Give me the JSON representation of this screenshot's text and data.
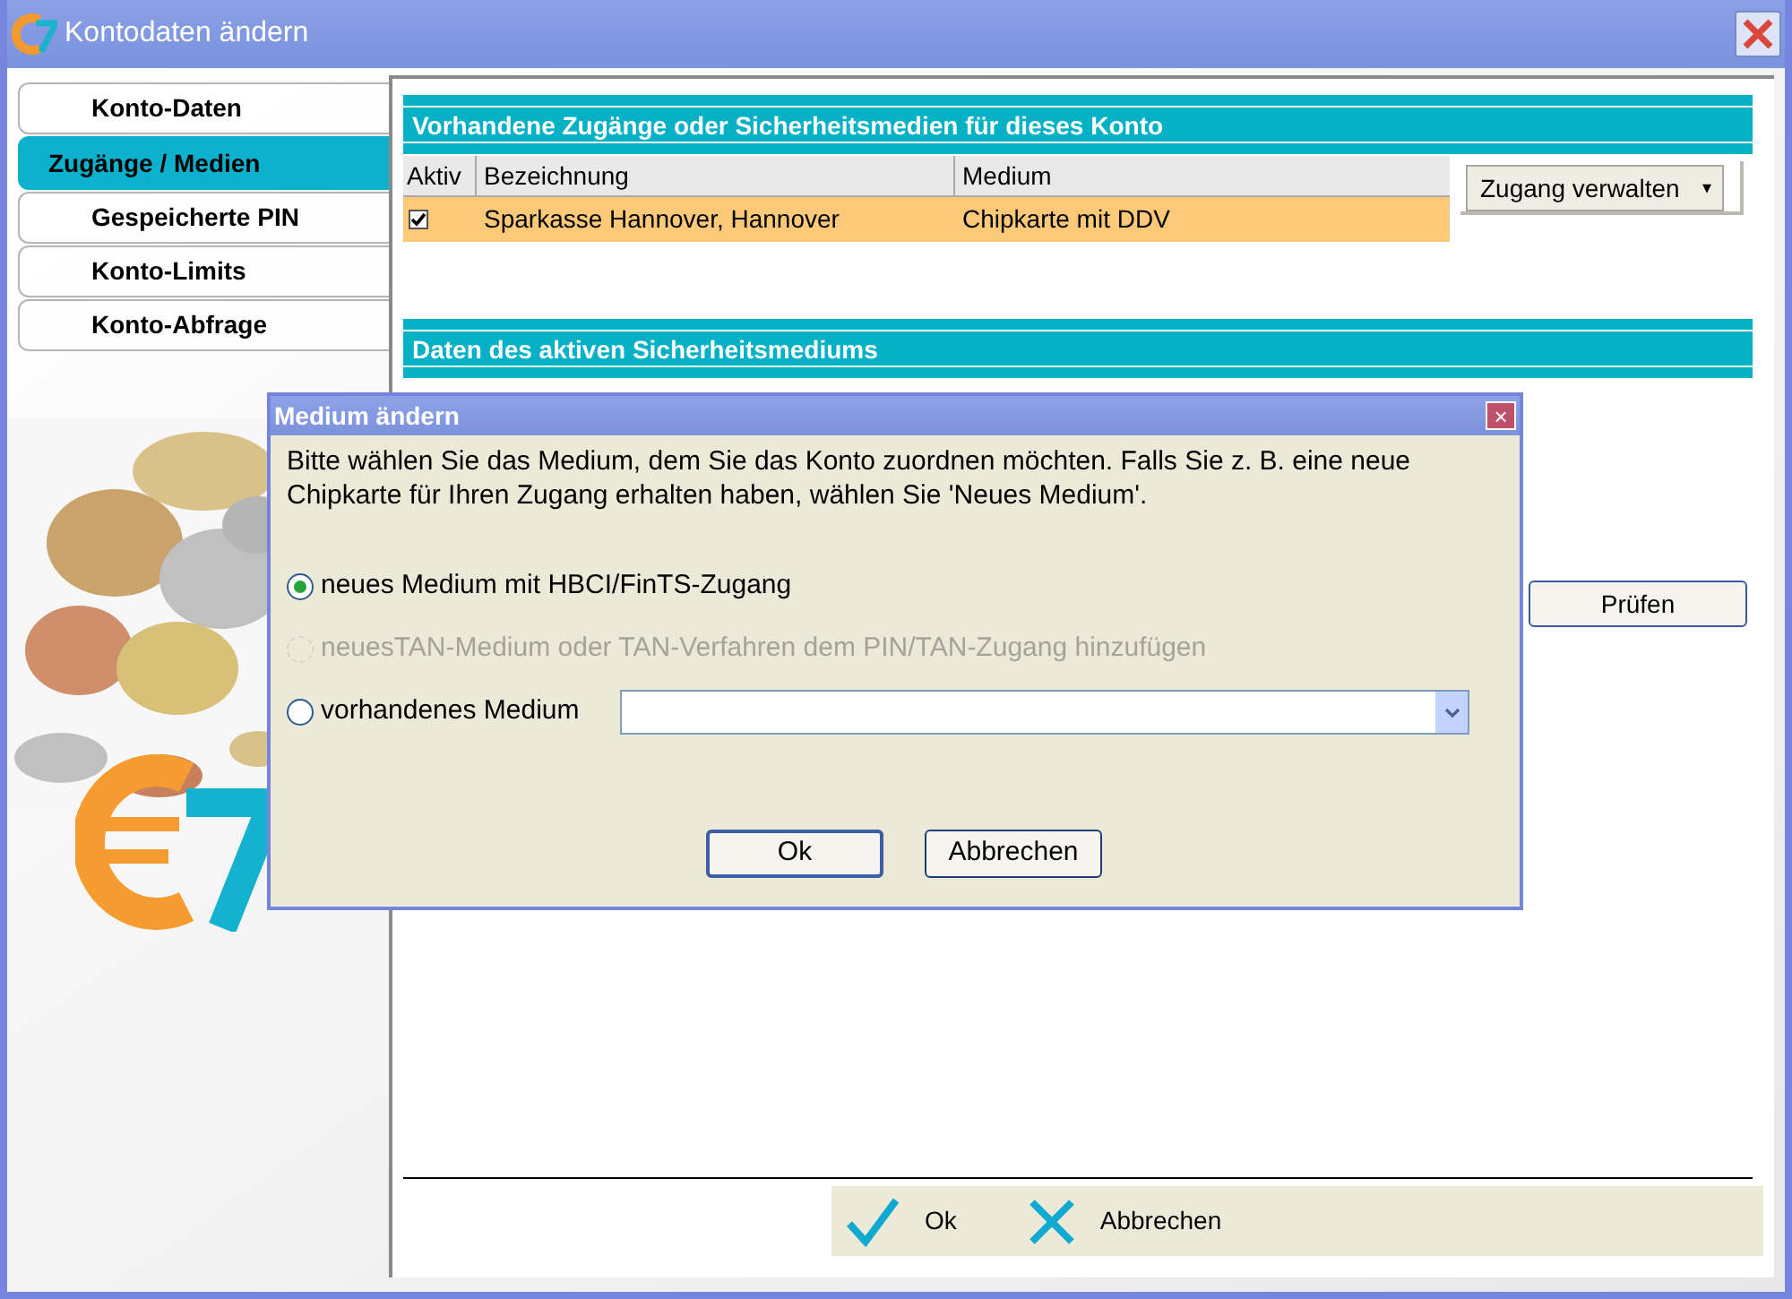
{
  "window": {
    "title": "Kontodaten ändern"
  },
  "tabs": [
    {
      "label": "Konto-Daten",
      "selected": false
    },
    {
      "label": "Zugänge / Medien",
      "selected": true
    },
    {
      "label": "Gespeicherte PIN",
      "selected": false
    },
    {
      "label": "Konto-Limits",
      "selected": false
    },
    {
      "label": "Konto-Abfrage",
      "selected": false
    }
  ],
  "access_section": {
    "title": "Vorhandene Zugänge oder Sicherheitsmedien für dieses Konto",
    "table": {
      "columns": [
        "Aktiv",
        "Bezeichnung",
        "Medium"
      ],
      "rows": [
        {
          "checked": true,
          "selected": true,
          "name": "Sparkasse Hannover, Hannover",
          "medium": "Chipkarte mit DDV"
        }
      ]
    },
    "manage_button": {
      "label": "Zugang verwalten",
      "caret": "▾"
    }
  },
  "medium_section": {
    "title": "Daten des aktiven Sicherheitsmediums",
    "check_button": "Prüfen"
  },
  "dialog": {
    "title": "Medium ändern",
    "close": "×",
    "message": "Bitte wählen Sie das Medium, dem Sie das Konto zuordnen möchten. Falls Sie z. B. eine neue Chipkarte für Ihren Zugang erhalten haben, wählen Sie 'Neues Medium'.",
    "options": [
      {
        "kind": "plain",
        "label": "neues Medium mit HBCI/FinTS-Zugang",
        "selected": true,
        "disabled": false
      },
      {
        "kind": "plain",
        "label": "neuesTAN-Medium oder TAN-Verfahren dem PIN/TAN-Zugang hinzufügen",
        "selected": false,
        "disabled": true
      },
      {
        "kind": "dropdown",
        "label": "vorhandenes Medium",
        "selected": false,
        "disabled": false
      }
    ],
    "buttons": [
      {
        "label": "Ok",
        "default": true
      },
      {
        "label": "Abbrechen",
        "default": false
      }
    ]
  },
  "footer_buttons": [
    {
      "kind": "ok",
      "label": "Ok"
    },
    {
      "kind": "cancel",
      "label": "Abbrechen"
    }
  ]
}
